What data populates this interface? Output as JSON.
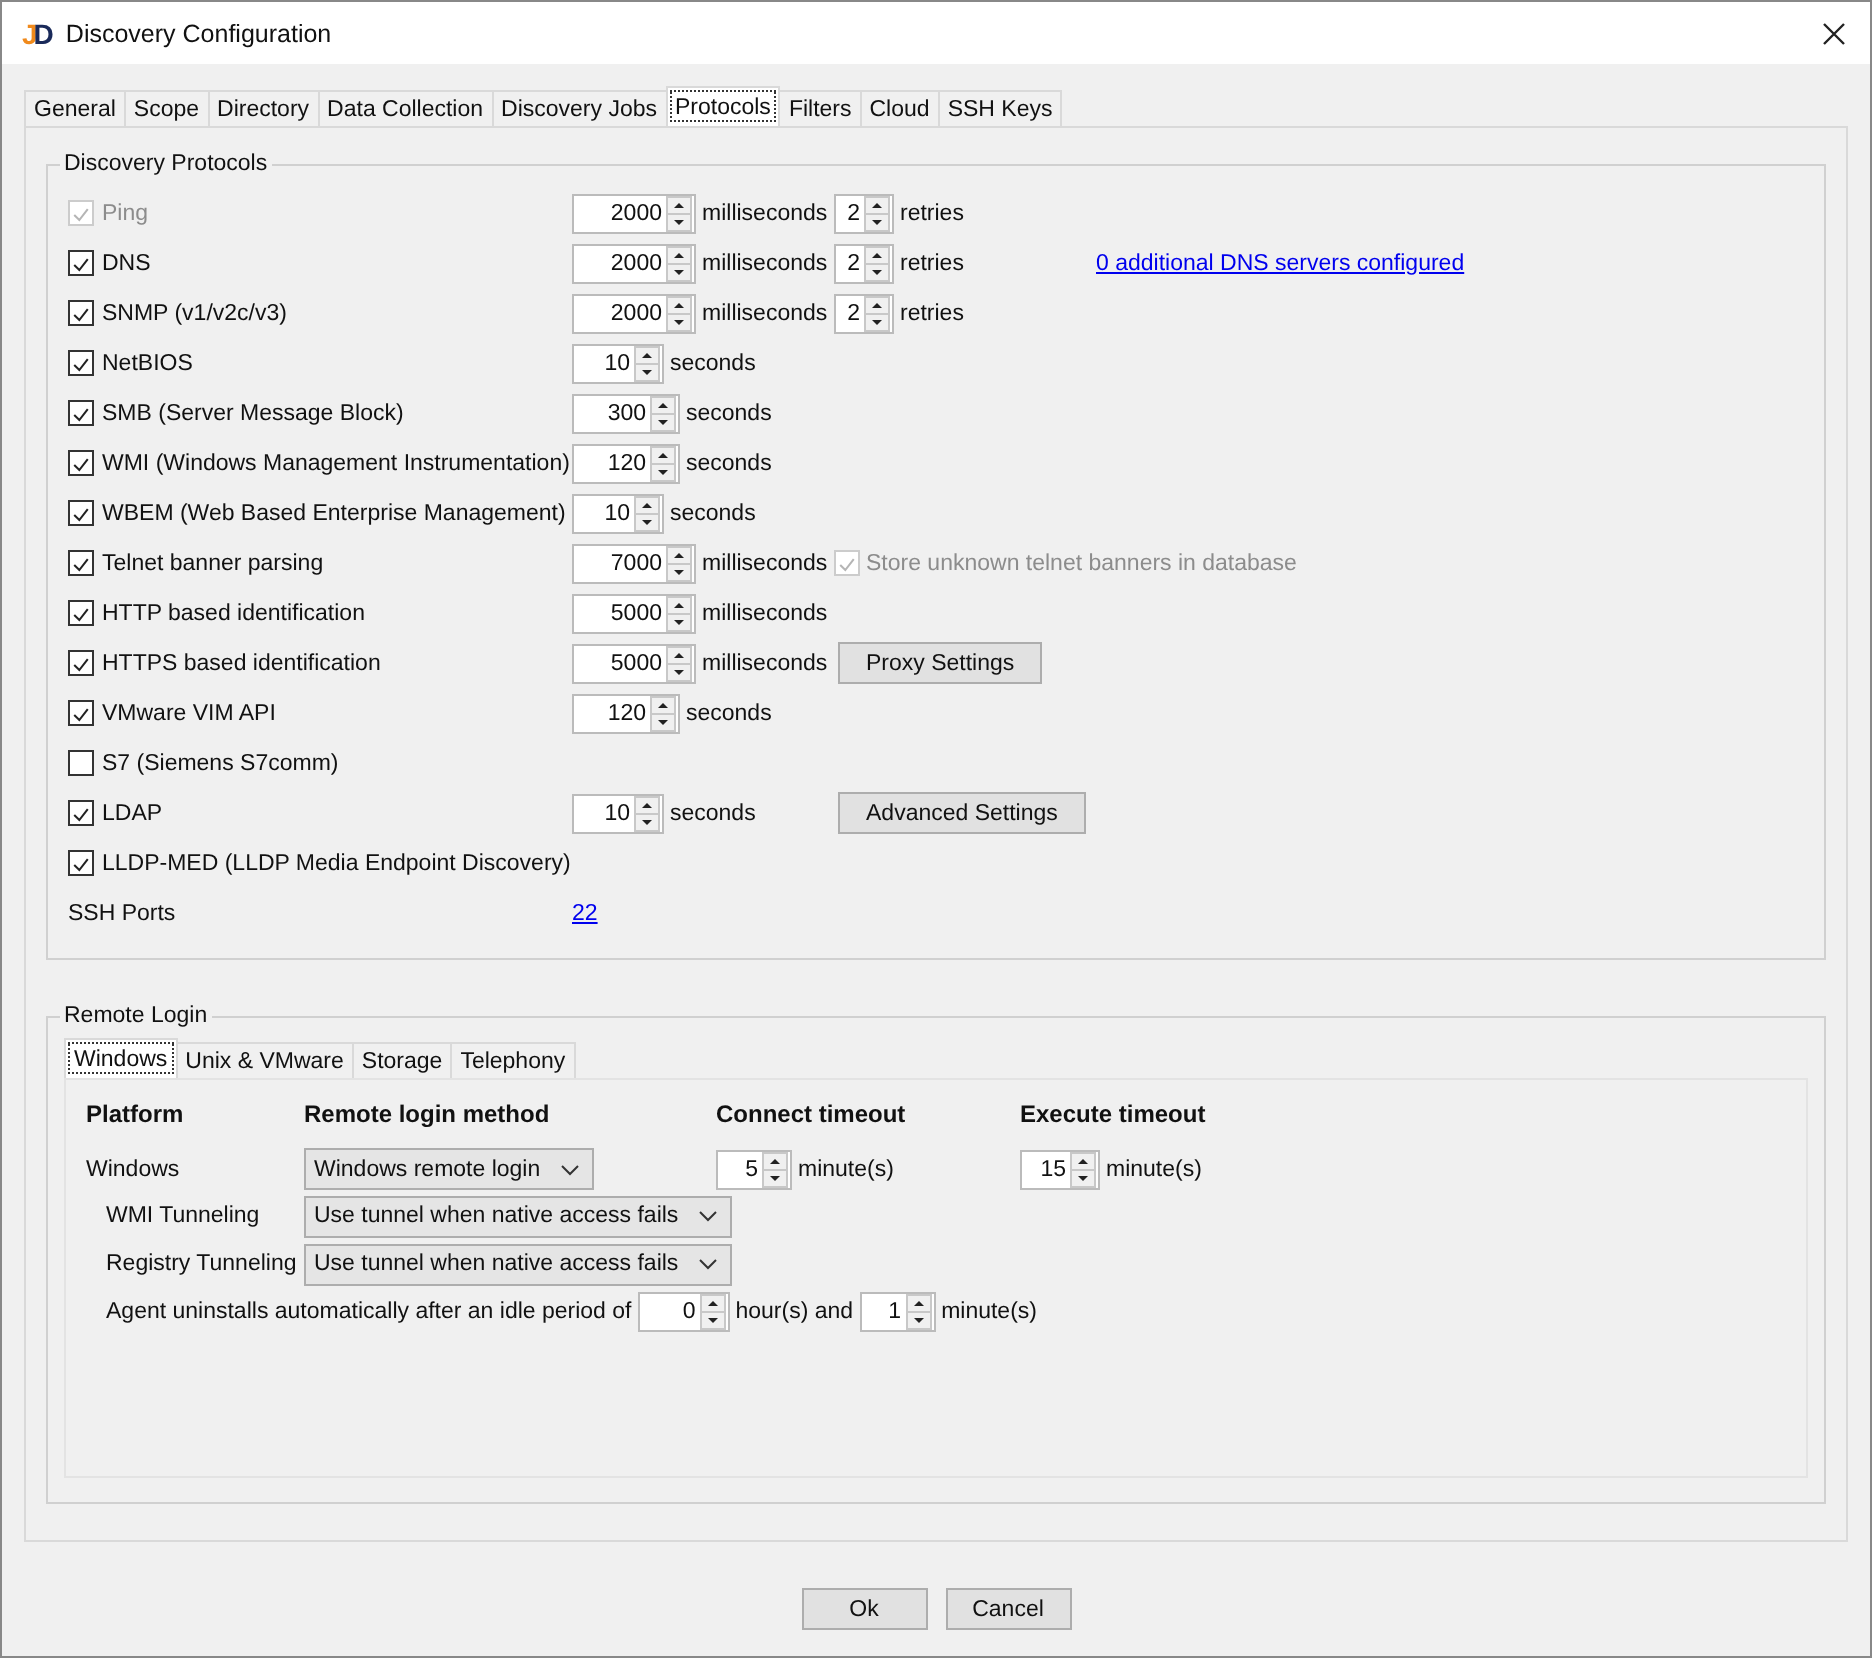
{
  "window": {
    "title": "Discovery Configuration",
    "logo": "JD"
  },
  "tabs": [
    {
      "label": "General",
      "selected": false
    },
    {
      "label": "Scope",
      "selected": false
    },
    {
      "label": "Directory",
      "selected": false
    },
    {
      "label": "Data Collection",
      "selected": false
    },
    {
      "label": "Discovery Jobs",
      "selected": false
    },
    {
      "label": "Protocols",
      "selected": true
    },
    {
      "label": "Filters",
      "selected": false
    },
    {
      "label": "Cloud",
      "selected": false
    },
    {
      "label": "SSH Keys",
      "selected": false
    }
  ],
  "discovery_protocols": {
    "title": "Discovery Protocols",
    "protocols": [
      {
        "label": "Ping",
        "checked": true,
        "disabled": true,
        "timeout": {
          "value": "2000",
          "unit": "milliseconds"
        },
        "retries": {
          "value": "2",
          "unit": "retries"
        }
      },
      {
        "label": "DNS",
        "checked": true,
        "disabled": false,
        "timeout": {
          "value": "2000",
          "unit": "milliseconds"
        },
        "retries": {
          "value": "2",
          "unit": "retries"
        },
        "extra": {
          "kind": "link",
          "label": "0 additional DNS servers configured"
        }
      },
      {
        "label": "SNMP (v1/v2c/v3)",
        "checked": true,
        "disabled": false,
        "timeout": {
          "value": "2000",
          "unit": "milliseconds"
        },
        "retries": {
          "value": "2",
          "unit": "retries"
        }
      },
      {
        "label": "NetBIOS",
        "checked": true,
        "disabled": false,
        "timeout": {
          "value": "10",
          "unit": "seconds"
        }
      },
      {
        "label": "SMB (Server Message Block)",
        "checked": true,
        "disabled": false,
        "timeout": {
          "value": "300",
          "unit": "seconds"
        }
      },
      {
        "label": "WMI (Windows Management Instrumentation)",
        "checked": true,
        "disabled": false,
        "timeout": {
          "value": "120",
          "unit": "seconds"
        }
      },
      {
        "label": "WBEM (Web Based Enterprise Management)",
        "checked": true,
        "disabled": false,
        "timeout": {
          "value": "10",
          "unit": "seconds"
        }
      },
      {
        "label": "Telnet banner parsing",
        "checked": true,
        "disabled": false,
        "timeout": {
          "value": "7000",
          "unit": "milliseconds"
        },
        "extra": {
          "kind": "checkbox",
          "label": "Store unknown telnet banners in database",
          "checked": true,
          "disabled": true
        }
      },
      {
        "label": "HTTP based identification",
        "checked": true,
        "disabled": false,
        "timeout": {
          "value": "5000",
          "unit": "milliseconds"
        }
      },
      {
        "label": "HTTPS based identification",
        "checked": true,
        "disabled": false,
        "timeout": {
          "value": "5000",
          "unit": "milliseconds"
        },
        "extra": {
          "kind": "button",
          "label": "Proxy Settings"
        }
      },
      {
        "label": "VMware VIM API",
        "checked": true,
        "disabled": false,
        "timeout": {
          "value": "120",
          "unit": "seconds"
        }
      },
      {
        "label": "S7 (Siemens S7comm)",
        "checked": false,
        "disabled": false
      },
      {
        "label": "LDAP",
        "checked": true,
        "disabled": false,
        "timeout": {
          "value": "10",
          "unit": "seconds"
        },
        "extra": {
          "kind": "button",
          "label": "Advanced Settings"
        }
      },
      {
        "label": "LLDP-MED (LLDP Media Endpoint Discovery)",
        "checked": true,
        "disabled": false
      }
    ],
    "ssh_ports": {
      "label": "SSH Ports",
      "value": "22"
    }
  },
  "remote_login": {
    "title": "Remote Login",
    "tabs": [
      {
        "label": "Windows",
        "selected": true
      },
      {
        "label": "Unix & VMware",
        "selected": false
      },
      {
        "label": "Storage",
        "selected": false
      },
      {
        "label": "Telephony",
        "selected": false
      }
    ],
    "headers": [
      "Platform",
      "Remote login method",
      "Connect timeout",
      "Execute timeout"
    ],
    "platform": "Windows",
    "method": "Windows remote login",
    "connect_timeout": {
      "value": "5",
      "unit": "minute(s)"
    },
    "execute_timeout": {
      "value": "15",
      "unit": "minute(s)"
    },
    "tunneling": [
      {
        "label": "WMI Tunneling",
        "value": "Use tunnel when native access fails"
      },
      {
        "label": "Registry Tunneling",
        "value": "Use tunnel when native access fails"
      }
    ],
    "agent": {
      "text": "Agent uninstalls automatically after an idle period of",
      "hours": {
        "value": "0",
        "unit": "hour(s) and"
      },
      "minutes": {
        "value": "1",
        "unit": "minute(s)"
      }
    }
  },
  "buttons": [
    "Ok",
    "Cancel"
  ]
}
